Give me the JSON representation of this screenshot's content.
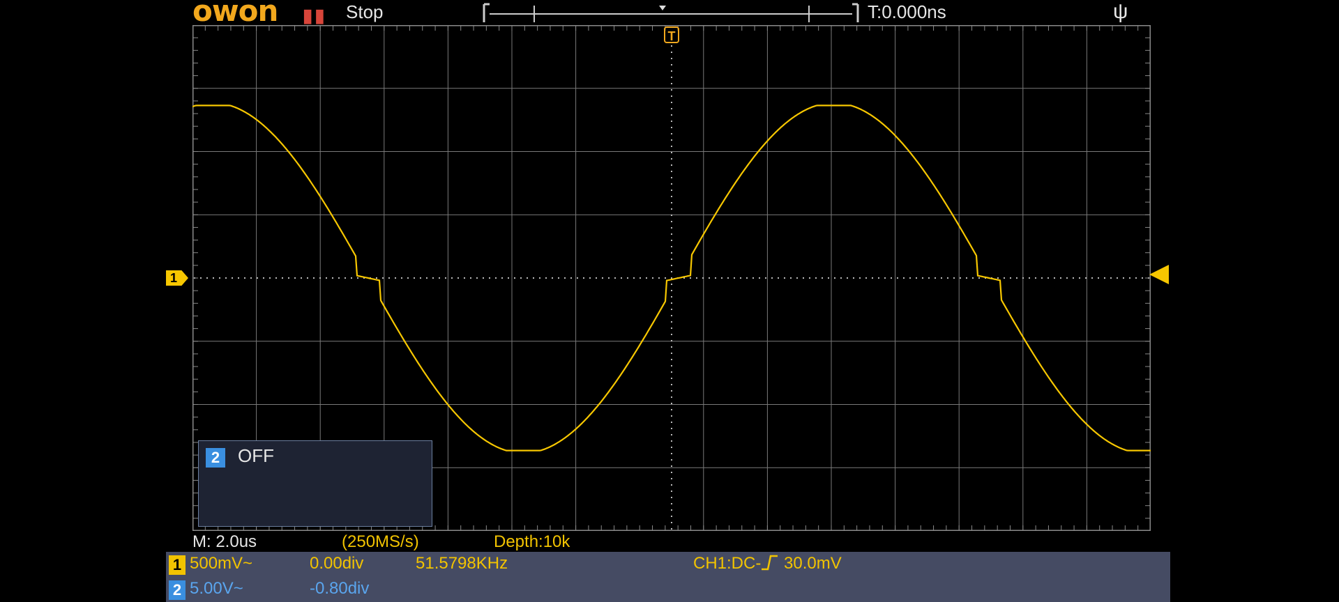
{
  "header": {
    "brand": "owon",
    "run_state_icon": "pause-icon",
    "run_state": "Stop",
    "trigger_delay": "T:0.000ns",
    "usb_icon": "usb-icon"
  },
  "display": {
    "grid_divisions": {
      "horizontal": 15,
      "vertical": 8
    },
    "trace_color": "#f7c700",
    "grid_color": "#7a7a7a",
    "trigger_marker_label": "T",
    "ch1_marker_label": "1"
  },
  "ch2_panel": {
    "badge": "2",
    "state": "OFF"
  },
  "status": {
    "timebase": "M: 2.0us",
    "sample_rate": "(250MS/s)",
    "depth": "Depth:10k"
  },
  "channels": [
    {
      "badge": "1",
      "scale": "500mV~",
      "offset": "0.00div",
      "frequency": "51.5798KHz",
      "badge_color": "#f2c300"
    },
    {
      "badge": "2",
      "scale": "5.00V~",
      "offset": "-0.80div",
      "badge_color": "#3a8fe0"
    }
  ],
  "trigger": {
    "label": "CH1:DC-",
    "level": "30.0mV"
  }
}
